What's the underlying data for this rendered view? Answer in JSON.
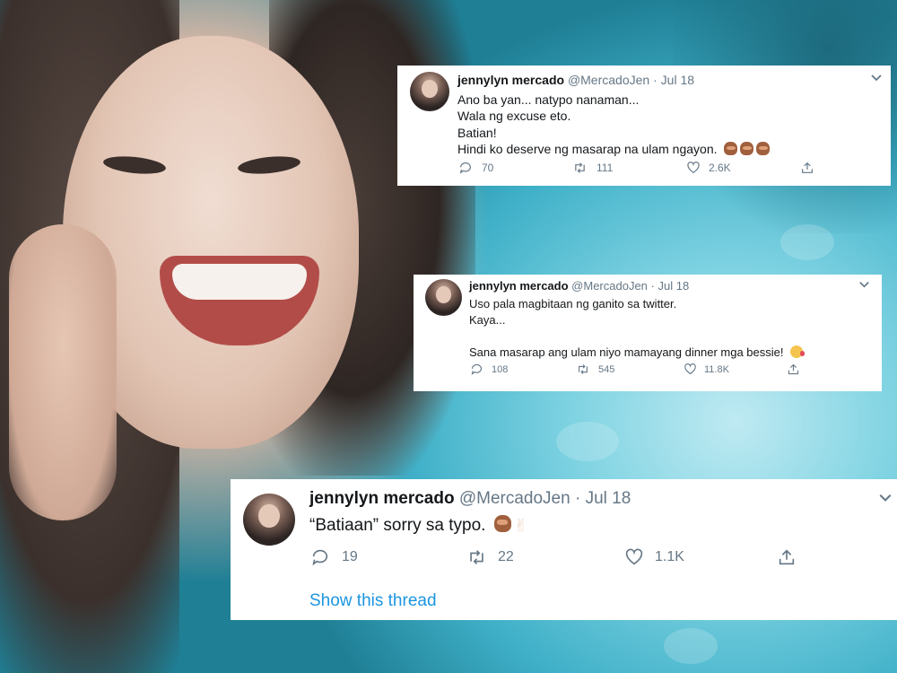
{
  "tweets": [
    {
      "name": "jennylyn mercado",
      "handle": "@MercadoJen",
      "separator": "·",
      "date": "Jul 18",
      "lines": [
        "Ano ba yan... natypo nanaman...",
        "Wala ng excuse eto.",
        "Batian!",
        "Hindi ko deserve ng masarap na ulam ngayon."
      ],
      "emoji": "see-no-evil-monkey x3",
      "replies": "70",
      "retweets": "111",
      "likes": "2.6K"
    },
    {
      "name": "jennylyn mercado",
      "handle": "@MercadoJen",
      "separator": "·",
      "date": "Jul 18",
      "lines": [
        "Uso pala magbitaan ng ganito sa twitter.",
        "Kaya...",
        "",
        "Sana masarap ang ulam niyo mamayang dinner mga bessie!"
      ],
      "emoji": "smiling-face-with-hearts",
      "replies": "108",
      "retweets": "545",
      "likes": "11.8K"
    },
    {
      "name": "jennylyn mercado",
      "handle": "@MercadoJen",
      "separator": "·",
      "date": "Jul 18",
      "lines": [
        "“Batiaan” sorry sa typo."
      ],
      "emoji": "see-no-evil-monkey, victory-hand",
      "replies": "19",
      "retweets": "22",
      "likes": "1.1K",
      "show_thread": "Show this thread"
    }
  ],
  "icons": {
    "reply": "reply-icon",
    "retweet": "retweet-icon",
    "like": "heart-icon",
    "share": "share-icon",
    "menu": "chevron-down-icon"
  },
  "colors": {
    "text": "#14171a",
    "muted": "#657786",
    "link": "#1b95e0",
    "card": "#ffffff"
  }
}
